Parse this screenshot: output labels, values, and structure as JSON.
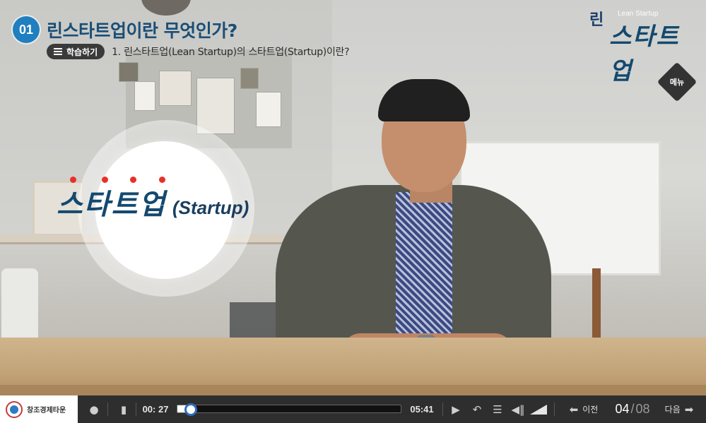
{
  "header": {
    "chapter_number": "01",
    "title": "린스타트업이란 무엇인가?",
    "study_button_label": "학습하기",
    "subtitle": "1. 린스타트업(Lean Startup)의 스타트업(Startup)이란?"
  },
  "logo": {
    "prefix": "린",
    "english": "Lean Startup",
    "korean": "스타트업"
  },
  "menu": {
    "label": "메뉴"
  },
  "keyword": {
    "korean": "스타트업",
    "english": "(Startup)"
  },
  "player": {
    "brand_text": "창조경제타운",
    "current_time": "00: 27",
    "total_time": "05:41",
    "progress_fraction": 0.08,
    "prev_label": "이전",
    "next_label": "다음",
    "page_current": "04",
    "page_separator": "/",
    "page_total": "08"
  },
  "icons": {
    "user": "user-icon",
    "book": "book-icon",
    "play": "play-icon",
    "repeat": "repeat-icon",
    "list": "list-icon",
    "volume": "volume-icon",
    "prev": "arrow-left-icon",
    "next": "arrow-right-icon"
  },
  "colors": {
    "accent_blue": "#1f7fc0",
    "title_navy": "#1a4e76",
    "dot_red": "#e8302a",
    "bar_bg": "#2e2e2e"
  }
}
